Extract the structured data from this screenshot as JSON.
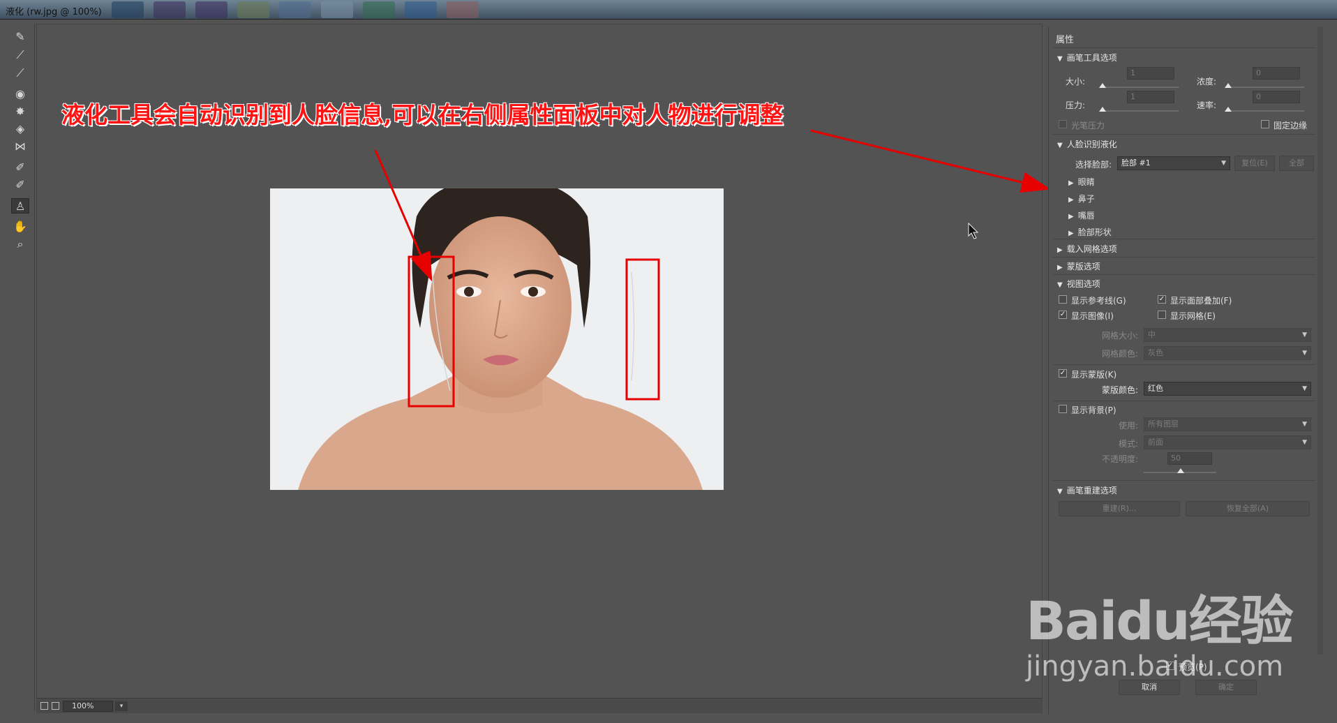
{
  "window": {
    "title": "液化 (rw.jpg @ 100%)"
  },
  "taskbar_icons": [
    "ps-icon",
    "ai-icon",
    "pr-icon",
    "chrome-icon",
    "app-icon",
    "app-icon-2",
    "excel-icon",
    "word-icon",
    "app-icon-3"
  ],
  "toolbar": {
    "tools": [
      {
        "name": "forward-warp-tool-icon",
        "glyph": "✎"
      },
      {
        "name": "reconstruct-tool-icon",
        "glyph": "⟋"
      },
      {
        "name": "smooth-tool-icon",
        "glyph": "⟋"
      },
      {
        "name": "twirl-tool-icon",
        "glyph": "◉"
      },
      {
        "name": "pucker-tool-icon",
        "glyph": "✸"
      },
      {
        "name": "bloat-tool-icon",
        "glyph": "◈"
      },
      {
        "name": "push-left-tool-icon",
        "glyph": "⋈"
      },
      {
        "name": "freeze-mask-tool-icon",
        "glyph": "✐"
      },
      {
        "name": "thaw-mask-tool-icon",
        "glyph": "✐"
      },
      {
        "name": "face-tool-icon",
        "glyph": "♙"
      },
      {
        "name": "hand-tool-icon",
        "glyph": "✋"
      },
      {
        "name": "zoom-tool-icon",
        "glyph": "⌕"
      }
    ]
  },
  "canvas": {
    "annotation": "液化工具会自动识别到人脸信息,可以在右侧属性面板中对人物进行调整",
    "zoom": "100%"
  },
  "panel": {
    "title": "属性",
    "brush_tool_options": {
      "header": "画笔工具选项",
      "size_label": "大小:",
      "size_value": "1",
      "density_label": "浓度:",
      "density_value": "0",
      "pressure_label": "压力:",
      "pressure_value": "1",
      "rate_label": "速率:",
      "rate_value": "0",
      "stylus_pressure": "光笔压力",
      "pin_edges": "固定边缘"
    },
    "face_aware": {
      "header": "人脸识别液化",
      "select_face_label": "选择脸部:",
      "select_face_value": "脸部 #1",
      "reset_button": "复位(E)",
      "all_button": "全部",
      "items": [
        "眼睛",
        "鼻子",
        "嘴唇",
        "脸部形状"
      ]
    },
    "load_mesh": {
      "header": "载入网格选项"
    },
    "mask_options": {
      "header": "蒙版选项"
    },
    "view_options": {
      "header": "视图选项",
      "show_guides": "显示参考线(G)",
      "show_face_overlay": "显示面部叠加(F)",
      "show_image": "显示图像(I)",
      "show_mesh": "显示网格(E)",
      "mesh_size_label": "网格大小:",
      "mesh_size_value": "中",
      "mesh_color_label": "网格颜色:",
      "mesh_color_value": "灰色",
      "show_mask": "显示蒙版(K)",
      "mask_color_label": "蒙版颜色:",
      "mask_color_value": "红色",
      "show_backdrop": "显示背景(P)",
      "use_label": "使用:",
      "use_value": "所有图层",
      "mode_label": "模式:",
      "mode_value": "前面",
      "opacity_label": "不透明度:",
      "opacity_value": "50"
    },
    "brush_reconstruct": {
      "header": "画笔重建选项",
      "reconstruct_button": "重建(R)...",
      "restore_all_button": "恢复全部(A)"
    },
    "preview": "预览(P)",
    "cancel_button": "取消",
    "ok_button": "确定"
  },
  "watermark": {
    "main": "Baidu经验",
    "sub": "jingyan.baidu.com"
  }
}
